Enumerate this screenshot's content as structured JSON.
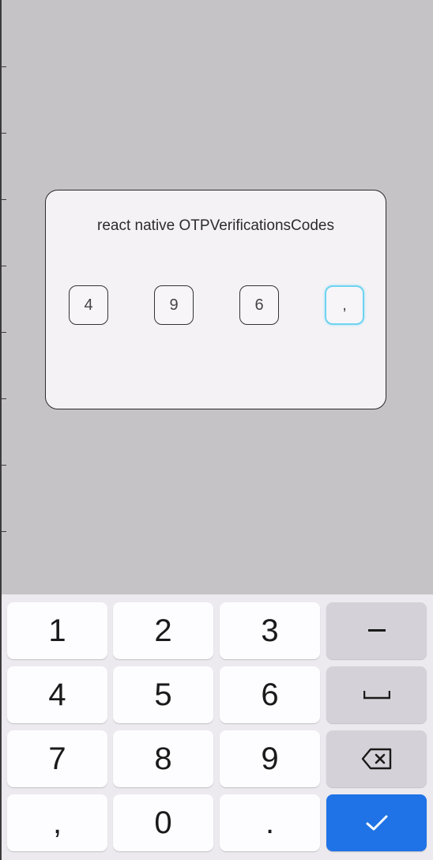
{
  "card": {
    "title": "react native OTPVerificationsCodes",
    "otp_digits": [
      "4",
      "9",
      "6",
      ","
    ],
    "focused_index": 3
  },
  "keyboard": {
    "rows": [
      [
        "1",
        "2",
        "3",
        "−"
      ],
      [
        "4",
        "5",
        "6",
        "␣"
      ],
      [
        "7",
        "8",
        "9",
        "⌫"
      ],
      [
        ",",
        "0",
        ".",
        "✓"
      ]
    ],
    "icons": {
      "minus": "minus-key",
      "space": "space-icon",
      "backspace": "backspace-icon",
      "done": "checkmark-icon"
    },
    "colors": {
      "done_key": "#1f73e6",
      "function_key": "#d4d2d8",
      "digit_key": "#fdfcfe",
      "focus_ring": "#6fd3f0"
    }
  }
}
